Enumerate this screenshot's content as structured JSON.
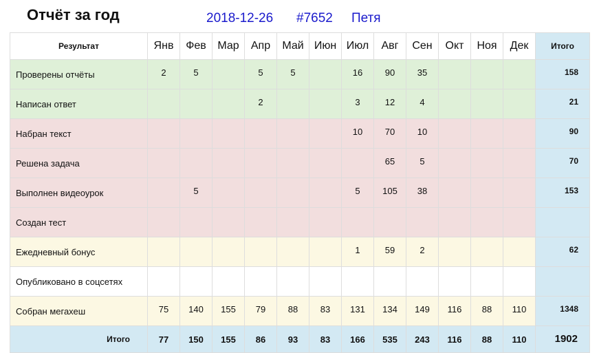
{
  "header": {
    "title": "Отчёт за год",
    "date": "2018-12-26",
    "number": "#7652",
    "user": "Петя"
  },
  "table": {
    "result_header": "Результат",
    "months": [
      "Янв",
      "Фев",
      "Мар",
      "Апр",
      "Май",
      "Июн",
      "Июл",
      "Авг",
      "Сен",
      "Окт",
      "Ноя",
      "Дек"
    ],
    "total_header": "Итого",
    "rows": [
      {
        "label": "Проверены отчёты",
        "group": "green",
        "values": [
          "2",
          "5",
          "",
          "5",
          "5",
          "",
          "16",
          "90",
          "35",
          "",
          "",
          ""
        ],
        "total": "158"
      },
      {
        "label": "Написан ответ",
        "group": "green",
        "values": [
          "",
          "",
          "",
          "2",
          "",
          "",
          "3",
          "12",
          "4",
          "",
          "",
          ""
        ],
        "total": "21"
      },
      {
        "label": "Набран текст",
        "group": "red",
        "values": [
          "",
          "",
          "",
          "",
          "",
          "",
          "10",
          "70",
          "10",
          "",
          "",
          ""
        ],
        "total": "90"
      },
      {
        "label": "Решена задача",
        "group": "red",
        "values": [
          "",
          "",
          "",
          "",
          "",
          "",
          "",
          "65",
          "5",
          "",
          "",
          ""
        ],
        "total": "70"
      },
      {
        "label": "Выполнен видеоурок",
        "group": "red",
        "values": [
          "",
          "5",
          "",
          "",
          "",
          "",
          "5",
          "105",
          "38",
          "",
          "",
          ""
        ],
        "total": "153"
      },
      {
        "label": "Создан тест",
        "group": "red",
        "values": [
          "",
          "",
          "",
          "",
          "",
          "",
          "",
          "",
          "",
          "",
          "",
          ""
        ],
        "total": ""
      },
      {
        "label": "Ежедневный бонус",
        "group": "yellow",
        "values": [
          "",
          "",
          "",
          "",
          "",
          "",
          "1",
          "59",
          "2",
          "",
          "",
          ""
        ],
        "total": "62"
      },
      {
        "label": "Опубликовано в соцсетях",
        "group": "white",
        "values": [
          "",
          "",
          "",
          "",
          "",
          "",
          "",
          "",
          "",
          "",
          "",
          ""
        ],
        "total": ""
      },
      {
        "label": "Собран мегахеш",
        "group": "yellow",
        "values": [
          "75",
          "140",
          "155",
          "79",
          "88",
          "83",
          "131",
          "134",
          "149",
          "116",
          "88",
          "110"
        ],
        "total": "1348"
      }
    ],
    "grand": {
      "label": "Итого",
      "values": [
        "77",
        "150",
        "155",
        "86",
        "93",
        "83",
        "166",
        "535",
        "243",
        "116",
        "88",
        "110"
      ],
      "total": "1902"
    }
  }
}
